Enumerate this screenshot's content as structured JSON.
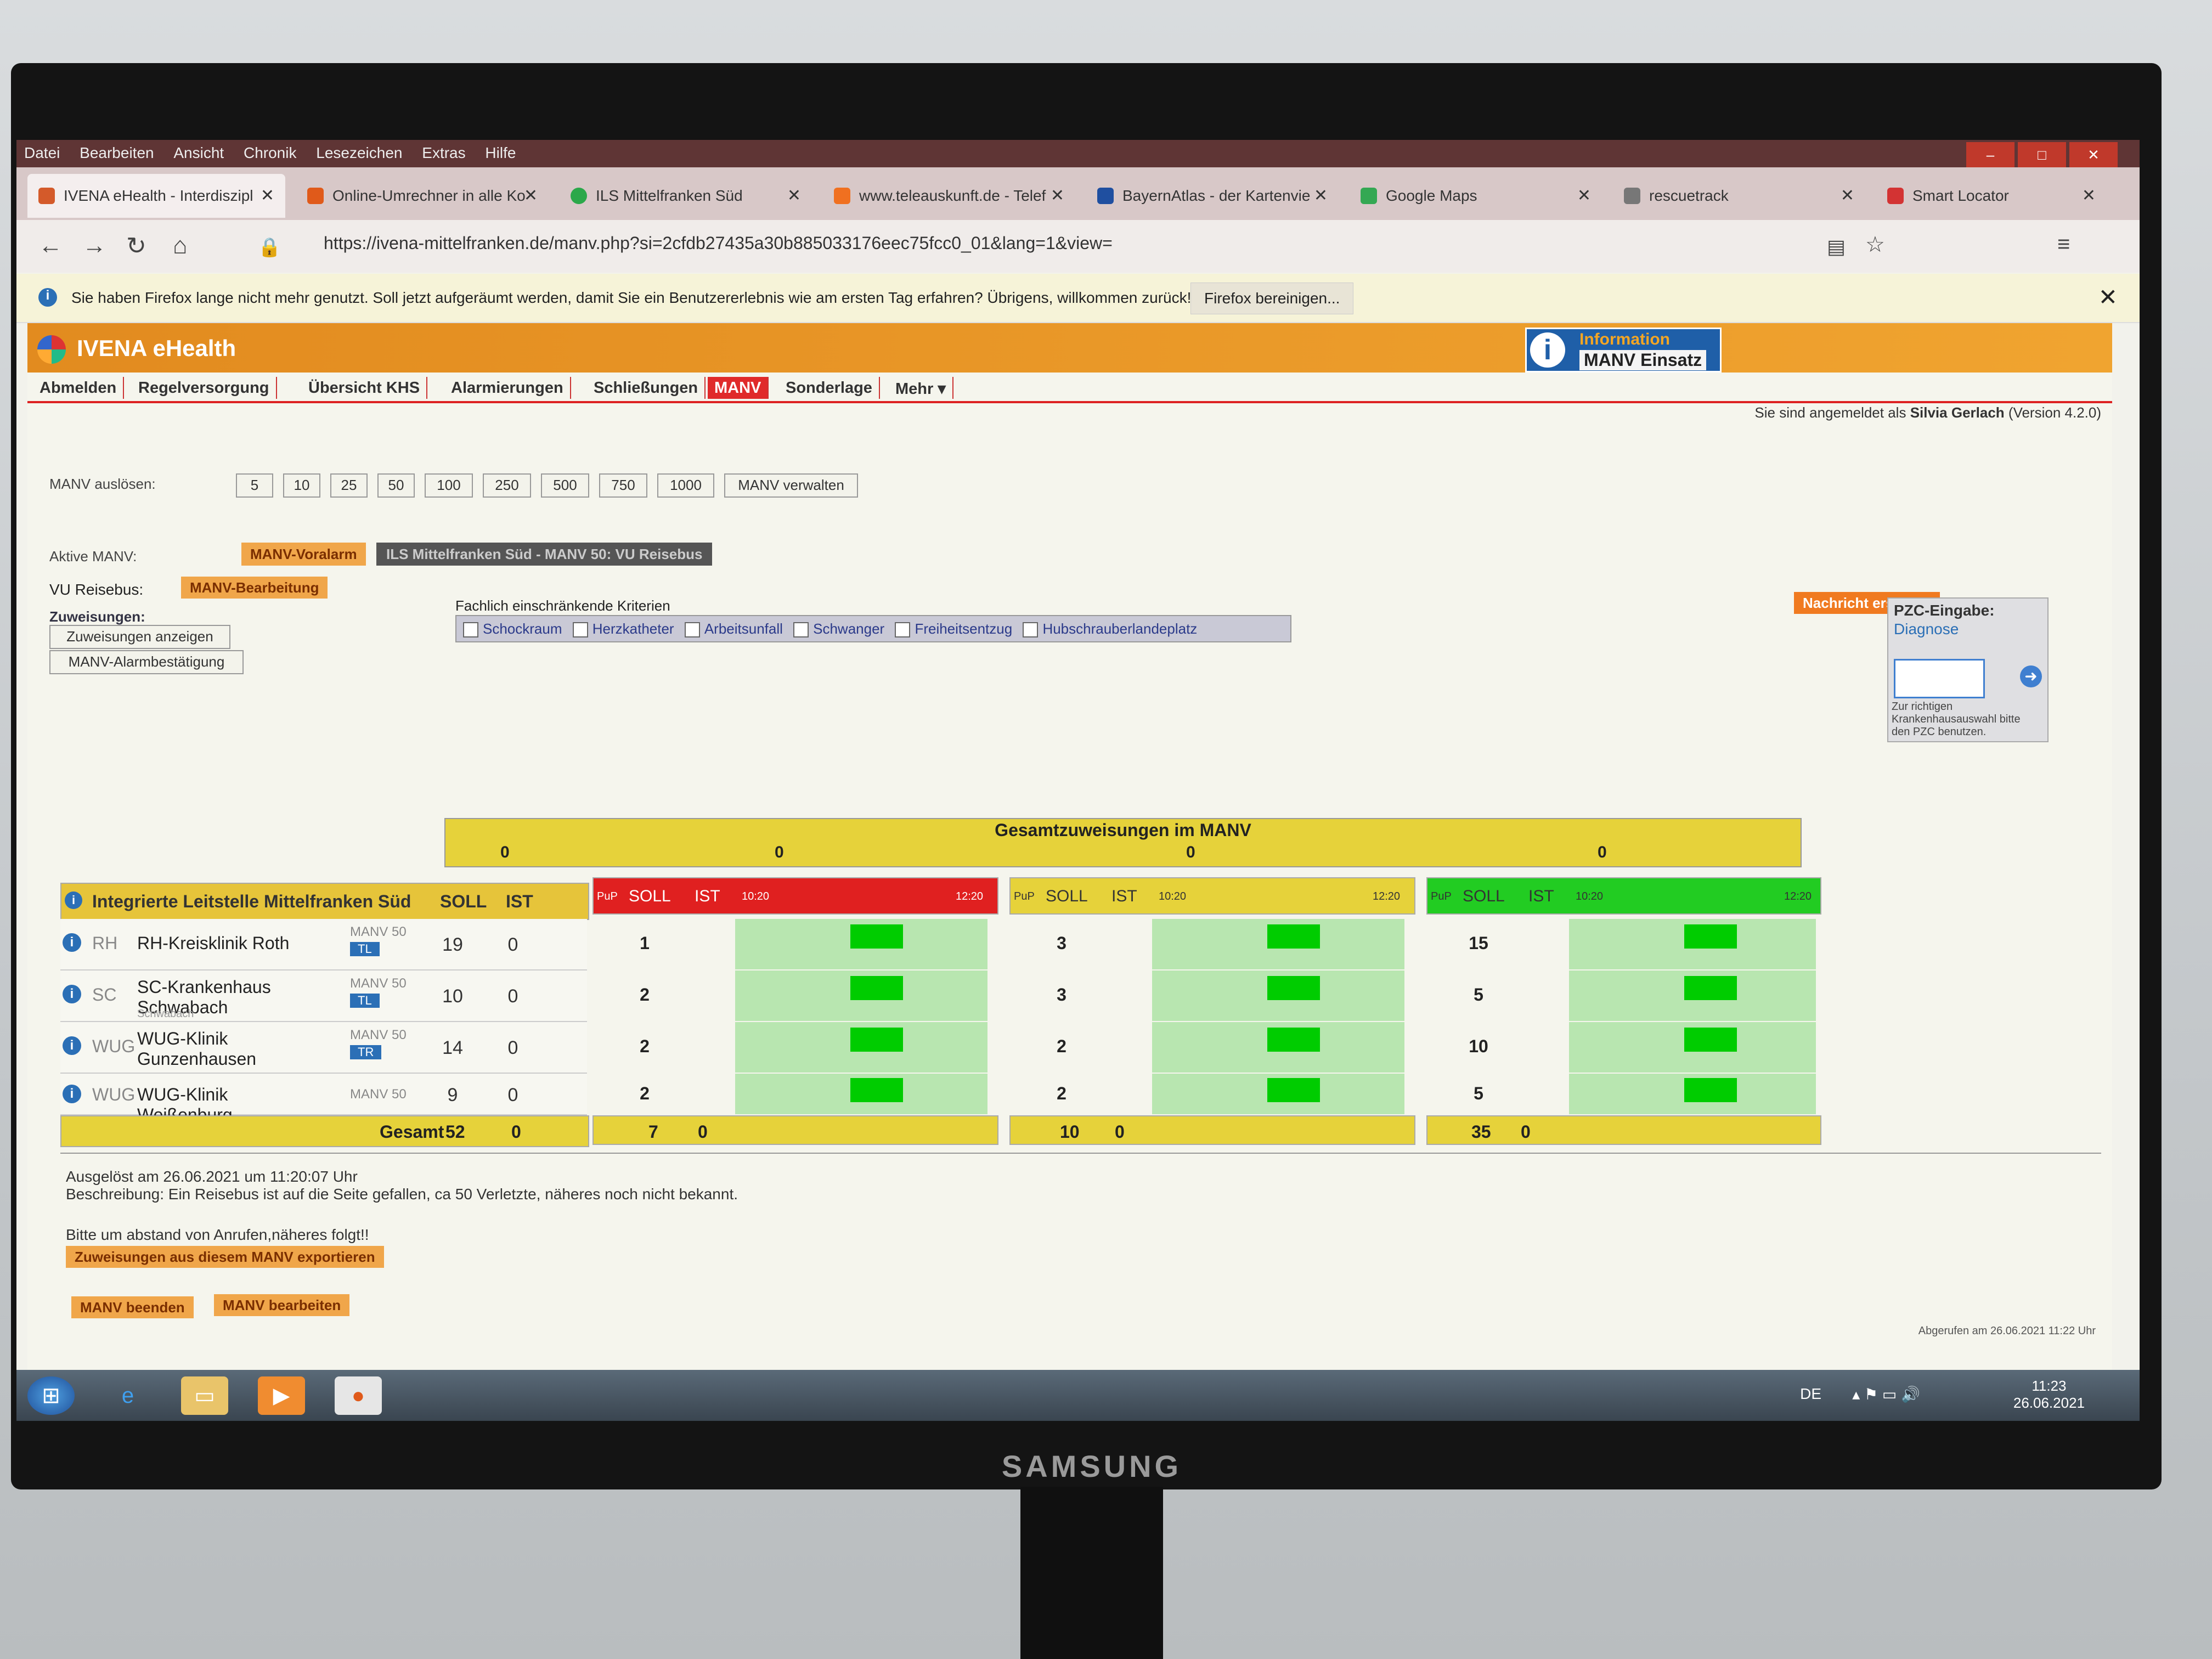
{
  "browser": {
    "menu": [
      "Datei",
      "Bearbeiten",
      "Ansicht",
      "Chronik",
      "Lesezeichen",
      "Extras",
      "Hilfe"
    ],
    "tabs": [
      {
        "label": "IVENA eHealth - Interdiszipl",
        "color": "#d45a2a",
        "active": true
      },
      {
        "label": "Online-Umrechner in alle Ko",
        "color": "#e05a1a",
        "active": false
      },
      {
        "label": "ILS Mittelfranken Süd",
        "color": "#2ba84a",
        "active": false
      },
      {
        "label": "www.teleauskunft.de - Telef",
        "color": "#f07020",
        "active": false
      },
      {
        "label": "BayernAtlas - der Kartenvie",
        "color": "#1f4fa0",
        "active": false
      },
      {
        "label": "Google Maps",
        "color": "#34a853",
        "active": false
      },
      {
        "label": "rescuetrack",
        "color": "#777777",
        "active": false
      },
      {
        "label": "Smart Locator",
        "color": "#d33333",
        "active": false
      }
    ],
    "url": "https://ivena-mittelfranken.de/manv.php?si=2cfdb27435a30b885033176eec75fcc0_01&lang=1&view=",
    "notice": "Sie haben Firefox lange nicht mehr genutzt. Soll jetzt aufgeräumt werden, damit Sie ein Benutzererlebnis wie am ersten Tag erfahren? Übrigens, willkommen zurück!",
    "notice_button": "Firefox bereinigen..."
  },
  "app": {
    "title": "IVENA eHealth",
    "info_line1": "Information",
    "info_line2": "MANV Einsatz",
    "menu": [
      "Abmelden",
      "Regelversorgung",
      "Übersicht KHS",
      "Alarmierungen",
      "Schließungen",
      "MANV",
      "Sonderlage",
      "Mehr"
    ],
    "active_menu": "MANV",
    "login_prefix": "Sie sind angemeldet als",
    "login_user": "Silvia Gerlach",
    "version": "(Version 4.2.0)"
  },
  "controls": {
    "manv_ausloesen_label": "MANV auslösen:",
    "manv_buttons": [
      "5",
      "10",
      "25",
      "50",
      "100",
      "250",
      "500",
      "750",
      "1000"
    ],
    "manv_verwalten": "MANV verwalten",
    "aktive_manv_label": "Aktive MANV:",
    "voralarm": "MANV-Voralarm",
    "active_manv": "ILS Mittelfranken Süd - MANV 50: VU Reisebus",
    "vu_label": "VU Reisebus:",
    "bearbeitung": "MANV-Bearbeitung",
    "zuweisungen_label": "Zuweisungen:",
    "zuweisungen_anzeigen": "Zuweisungen anzeigen",
    "alarmbestaetigung": "MANV-Alarmbestätigung",
    "kriterien_label": "Fachlich einschränkende Kriterien",
    "kriterien": [
      "Schockraum",
      "Herzkatheter",
      "Arbeitsunfall",
      "Schwanger",
      "Freiheitsentzug",
      "Hubschrauberlandeplatz"
    ],
    "nachricht": "Nachricht erstellen",
    "pzc_label": "PZC-Eingabe:",
    "pzc_diagnose": "Diagnose",
    "pzc_hint": "Zur richtigen Krankenhausauswahl bitte den PZC benutzen."
  },
  "gesamt": {
    "title": "Gesamtzuweisungen im MANV",
    "values": [
      "0",
      "0",
      "0",
      "0"
    ]
  },
  "table": {
    "header_name": "Integrierte Leitstelle Mittelfranken Süd",
    "col_soll": "SOLL",
    "col_ist": "IST",
    "pup": "PuP",
    "time_start": "10:20",
    "time_end": "12:20",
    "rows": [
      {
        "abk": "RH",
        "name": "RH-Kreisklinik Roth",
        "sub": "",
        "manv": "MANV 50",
        "badge": "TL",
        "soll": "19",
        "ist": "0",
        "g1": "1",
        "g2": "3",
        "g3": "15"
      },
      {
        "abk": "SC",
        "name": "SC-Krankenhaus Schwabach",
        "sub": "Schwabach",
        "manv": "MANV 50",
        "badge": "TL",
        "soll": "10",
        "ist": "0",
        "g1": "2",
        "g2": "3",
        "g3": "5"
      },
      {
        "abk": "WUG",
        "name": "WUG-Klinik Gunzenhausen",
        "sub": "",
        "manv": "MANV 50",
        "badge": "TR",
        "soll": "14",
        "ist": "0",
        "g1": "2",
        "g2": "2",
        "g3": "10"
      },
      {
        "abk": "WUG",
        "name": "WUG-Klinik Weißenburg",
        "sub": "",
        "manv": "MANV 50",
        "badge": "",
        "soll": "9",
        "ist": "0",
        "g1": "2",
        "g2": "2",
        "g3": "5"
      }
    ],
    "sum_label": "Gesamt",
    "sum_soll": "52",
    "sum_ist": "0",
    "group_sums": [
      {
        "soll": "7",
        "ist": "0"
      },
      {
        "soll": "10",
        "ist": "0"
      },
      {
        "soll": "35",
        "ist": "0"
      }
    ],
    "group_colors": [
      "#e02020",
      "#e6d23a",
      "#22cc22"
    ]
  },
  "footer": {
    "ausgeloest": "Ausgelöst am 26.06.2021 um 11:20:07 Uhr",
    "beschreibung": "Beschreibung: Ein Reisebus ist auf die Seite gefallen, ca 50 Verletzte, näheres noch nicht bekannt.",
    "hinweis": "Bitte um abstand von Anrufen,näheres folgt!!",
    "export": "Zuweisungen aus diesem MANV exportieren",
    "beenden": "MANV beenden",
    "bearbeiten": "MANV bearbeiten",
    "abgerufen": "Abgerufen am 26.06.2021 11:22 Uhr"
  },
  "taskbar": {
    "lang": "DE",
    "time": "11:23",
    "date": "26.06.2021"
  },
  "monitor_brand": "SAMSUNG"
}
